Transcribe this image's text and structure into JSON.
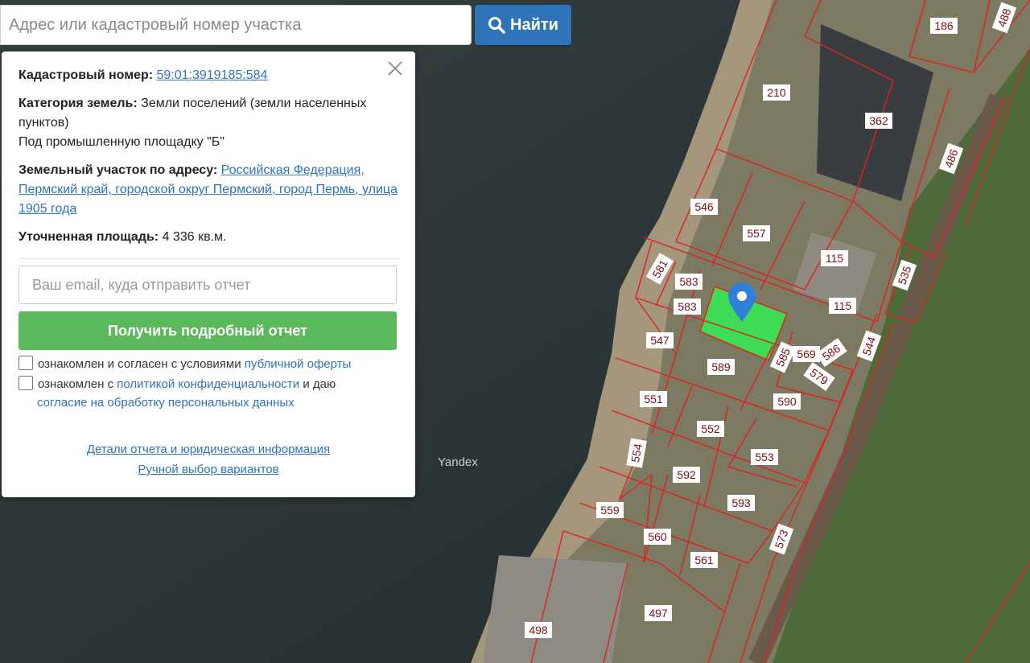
{
  "search": {
    "placeholder": "Адрес или кадастровый номер участка",
    "button_label": "Найти",
    "button_icon": "search-icon"
  },
  "panel": {
    "cadastral_label": "Кадастровый номер:",
    "cadastral_value": "59:01:3919185:584",
    "category_label": "Категория земель:",
    "category_value": "Земли поселений (земли населенных пунктов)",
    "purpose": "Под промышленную площадку \"Б\"",
    "address_label": "Земельный участок по адресу:",
    "address_value": "Российская Федерация, Пермский край, городской округ Пермский, город Пермь, улица 1905 года",
    "area_label": "Уточненная площадь:",
    "area_value": "4 336 кв.м.",
    "email_placeholder": "Ваш email, куда отправить отчет",
    "report_button": "Получить подробный отчет",
    "consent1_text": "ознакомлен и согласен с условиями",
    "consent1_link": "публичной оферты",
    "consent2_text_a": "ознакомлен с",
    "consent2_link_a": "политикой конфиденциальности",
    "consent2_text_b": "и даю",
    "consent2_link_b": "согласие на обработку персональных данных",
    "details_link": "Детали отчета и юридическая информация",
    "manual_link": "Ручной выбор вариантов"
  },
  "map": {
    "watermark": "Yandex",
    "parcel_labels": [
      "210",
      "362",
      "186",
      "488",
      "486",
      "546",
      "557",
      "115",
      "115",
      "535",
      "581",
      "583",
      "583",
      "547",
      "589",
      "585",
      "569",
      "586",
      "579",
      "544",
      "551",
      "590",
      "552",
      "554",
      "553",
      "592",
      "593",
      "559",
      "560",
      "573",
      "561",
      "497",
      "498"
    ],
    "selected_parcel_color": "#3ddc54",
    "boundary_color": "#e02020",
    "marker_color": "#2f7fd8"
  }
}
